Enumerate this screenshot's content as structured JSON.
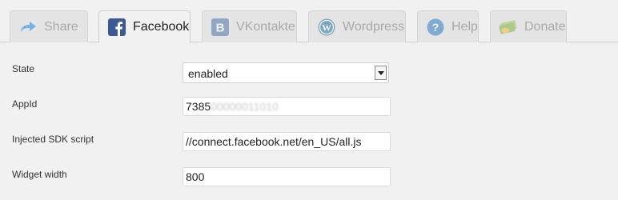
{
  "tabs": [
    {
      "label": "Share",
      "icon": "share-arrow-icon",
      "active": false
    },
    {
      "label": "Facebook",
      "icon": "facebook-icon",
      "active": true
    },
    {
      "label": "VKontakte",
      "icon": "vkontakte-icon",
      "active": false
    },
    {
      "label": "Wordpress",
      "icon": "wordpress-icon",
      "active": false
    },
    {
      "label": "Help",
      "icon": "help-icon",
      "active": false
    },
    {
      "label": "Donate",
      "icon": "donate-money-icon",
      "active": false
    }
  ],
  "form": {
    "state": {
      "label": "State",
      "value": "enabled"
    },
    "appid": {
      "label": "AppId",
      "value_visible": "7385",
      "value_hidden": "00000011010"
    },
    "sdk": {
      "label": "Injected SDK script",
      "value": "//connect.facebook.net/en_US/all.js"
    },
    "width": {
      "label": "Widget width",
      "value": "800"
    }
  },
  "colors": {
    "facebook_blue": "#3b5998",
    "vk_blue": "#4a76a8",
    "wordpress_blue": "#21759b",
    "help_blue": "#2e7bc4",
    "donate_green": "#7cb342",
    "share_blue": "#1e88e5"
  }
}
